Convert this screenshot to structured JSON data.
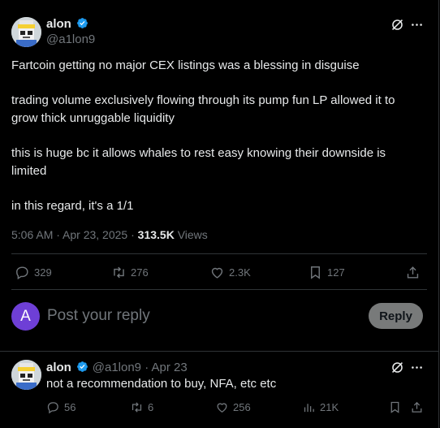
{
  "post": {
    "author_name": "alon",
    "author_handle": "@a1lon9",
    "paragraphs": [
      "Fartcoin getting no major CEX listings was a blessing in disguise",
      "trading volume exclusively flowing through its pump fun LP allowed it to",
      "grow thick unruggable liquidity",
      "this is huge bc it allows whales to rest easy knowing their downside is",
      "limited",
      "in this regard, it's a 1/1"
    ],
    "time": "5:06 AM · Apr 23, 2025 · ",
    "views_count": "313.5K",
    "views_label": " Views",
    "actions": {
      "replies": "329",
      "reposts": "276",
      "likes": "2.3K",
      "bookmarks": "127"
    }
  },
  "reply_box": {
    "avatar_letter": "A",
    "placeholder": "Post your reply",
    "button_label": "Reply"
  },
  "reply": {
    "author_name": "alon",
    "author_handle": "@a1lon9 · Apr 23",
    "text": "not a recommendation to buy, NFA, etc etc",
    "actions": {
      "replies": "56",
      "reposts": "6",
      "likes": "256",
      "views": "21K"
    }
  },
  "colors": {
    "background": "#000000",
    "text": "#e7e9ea",
    "muted": "#71767b",
    "verified": "#1d9bf0",
    "reply_avatar": "#6e3fd6"
  }
}
